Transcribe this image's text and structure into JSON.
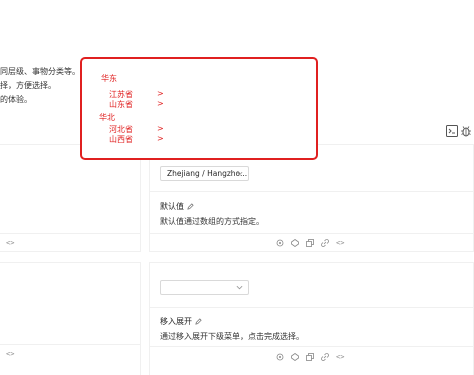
{
  "intro": {
    "line1": "同层级、事物分类等。",
    "line2": "择，方便选择。",
    "line3": "的体验。"
  },
  "toolbar": {
    "code_icon": "terminal-icon",
    "debug_icon": "bug-icon"
  },
  "demo_default": {
    "cascader_value": "Zhejiang / Hangzho...",
    "title": "默认值",
    "description": "默认值通过数组的方式指定。"
  },
  "demo_hover": {
    "cascader_placeholder": "",
    "title": "移入展开",
    "description": "通过移入展开下级菜单，点击完成选择。"
  },
  "code_toggle": "<>",
  "dropdown": {
    "groups": [
      {
        "label": "华东",
        "items": [
          {
            "label": "江苏省",
            "arrow": ">"
          },
          {
            "label": "山东省",
            "arrow": ">"
          }
        ]
      },
      {
        "label": "华北",
        "items": [
          {
            "label": "河北省",
            "arrow": ">"
          },
          {
            "label": "山西省",
            "arrow": ">"
          }
        ]
      }
    ],
    "accent_color": "#e02020"
  }
}
